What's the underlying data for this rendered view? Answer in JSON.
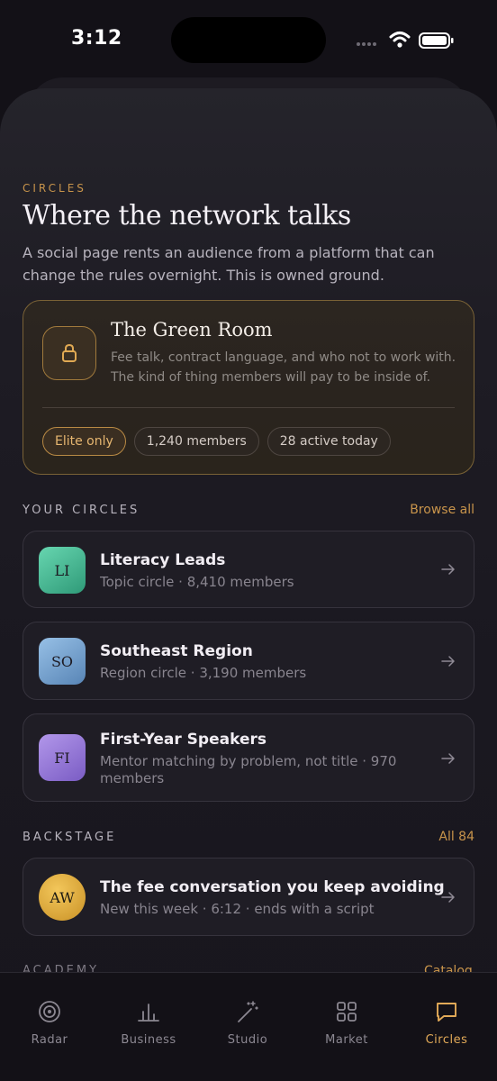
{
  "status": {
    "time": "3:12"
  },
  "header": {
    "eyebrow": "CIRCLES",
    "title": "Where the network talks",
    "intro": "A social page rents an audience from a platform that can change the rules overnight. This is owned ground."
  },
  "featured": {
    "title": "The Green Room",
    "description": "Fee talk, contract language, and who not to work with. The kind of thing members will pay to be inside of.",
    "chips": [
      "Elite only",
      "1,240 members",
      "28 active today"
    ],
    "icon": "lock-icon"
  },
  "your_circles": {
    "label": "YOUR CIRCLES",
    "link": "Browse all",
    "items": [
      {
        "initials": "LI",
        "title": "Literacy Leads",
        "subtitle": "Topic circle · 8,410 members",
        "color": "#3fb98f"
      },
      {
        "initials": "SO",
        "title": "Southeast Region",
        "subtitle": "Region circle · 3,190 members",
        "color": "#79a4d0"
      },
      {
        "initials": "FI",
        "title": "First-Year Speakers",
        "subtitle": "Mentor matching by problem, not title · 970 members",
        "color": "#9679dc"
      }
    ]
  },
  "backstage": {
    "label": "BACKSTAGE",
    "link": "All 84",
    "items": [
      {
        "initials": "AW",
        "title": "The fee conversation you keep avoiding",
        "subtitle": "New this week · 6:12 · ends with a script",
        "color": "#e2ad3d"
      }
    ]
  },
  "academy": {
    "label": "ACADEMY",
    "link": "Catalog"
  },
  "tabs": [
    {
      "label": "Radar",
      "icon": "radar-icon"
    },
    {
      "label": "Business",
      "icon": "bar-chart-icon"
    },
    {
      "label": "Studio",
      "icon": "magic-wand-icon"
    },
    {
      "label": "Market",
      "icon": "grid-icon"
    },
    {
      "label": "Circles",
      "icon": "chat-bubble-icon",
      "active": true
    }
  ],
  "colors": {
    "accent": "#c8944b",
    "background": "#131117"
  }
}
